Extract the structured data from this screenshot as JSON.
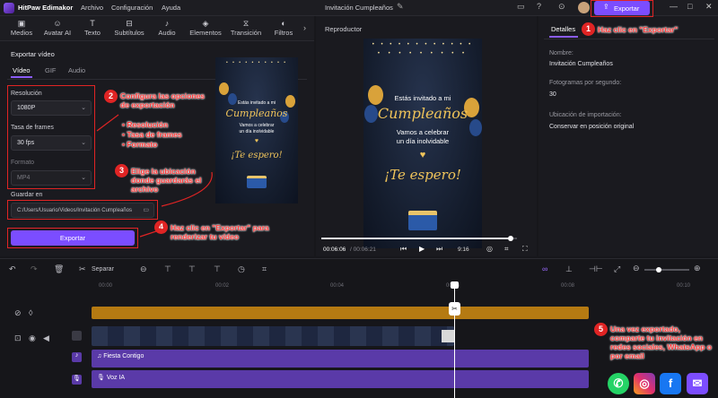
{
  "app": {
    "title": "HitPaw Edimakor",
    "project": "Invitación Cumpleaños"
  },
  "menu": [
    "Archivo",
    "Configuración",
    "Ayuda"
  ],
  "export_top_label": "Exportar",
  "toolbar": [
    "Medios",
    "Avatar AI",
    "Texto",
    "Subtítulos",
    "Audio",
    "Elementos",
    "Transición",
    "Filtros"
  ],
  "export_panel": {
    "title": "Exportar vídeo",
    "tabs": [
      "Vídeo",
      "GIF",
      "Audio"
    ],
    "resolution_label": "Resolución",
    "resolution_value": "1080P",
    "framerate_label": "Tasa de frames",
    "framerate_value": "30 fps",
    "format_label": "Formato",
    "format_value": "MP4",
    "save_label": "Guardar en",
    "save_path": "C:/Users/Usuario/Videos/Invitación Cumpleaños",
    "export_button": "Exportar"
  },
  "invitation": {
    "line1": "Estás invitado a mi",
    "line2": "Cumpleaños",
    "line3": "Vamos a celebrar",
    "line4": "un día inolvidable",
    "line5": "¡Te espero!"
  },
  "player": {
    "title": "Reproductor",
    "current_time": "00:06:06",
    "total_time": "/ 00:06:21",
    "aspect": "9:16",
    "progress": 0.97
  },
  "details": {
    "tab": "Detalles",
    "name_label": "Nombre:",
    "name_value": "Invitación Cumpleaños",
    "fps_label": "Fotogramas por segundo:",
    "fps_value": "30",
    "import_label": "Ubicación de importación:",
    "import_value": "Conservar en posición original"
  },
  "timeline": {
    "split_label": "Separar",
    "ruler": [
      "00:00",
      "00:02",
      "00:04",
      "00:06",
      "00:08",
      "00:10"
    ],
    "audio_tracks": [
      "Fiesta Contigo",
      "Voz IA"
    ]
  },
  "annotations": {
    "a1": "Haz clic en \"Exportar\"",
    "a2_title": "Configura las opciones de exportación",
    "a2_items": [
      "Resolución",
      "Tasa de frames",
      "Formato"
    ],
    "a3": "Elige la ubicación donde guardarás el archivo",
    "a4": "Haz clic en \"Exportar\" para renderizar tu vídeo",
    "a5": "Una vez exportado, comparte tu invitación en redes sociales, WhatsApp o por email",
    "numbers": [
      "1",
      "2",
      "3",
      "4",
      "5"
    ]
  },
  "colors": {
    "accent": "#7b4dff",
    "annotation_red": "#e02424",
    "gold": "#f0c45a",
    "video_track": "#b57a12",
    "audio_track": "#5a3aa8"
  }
}
